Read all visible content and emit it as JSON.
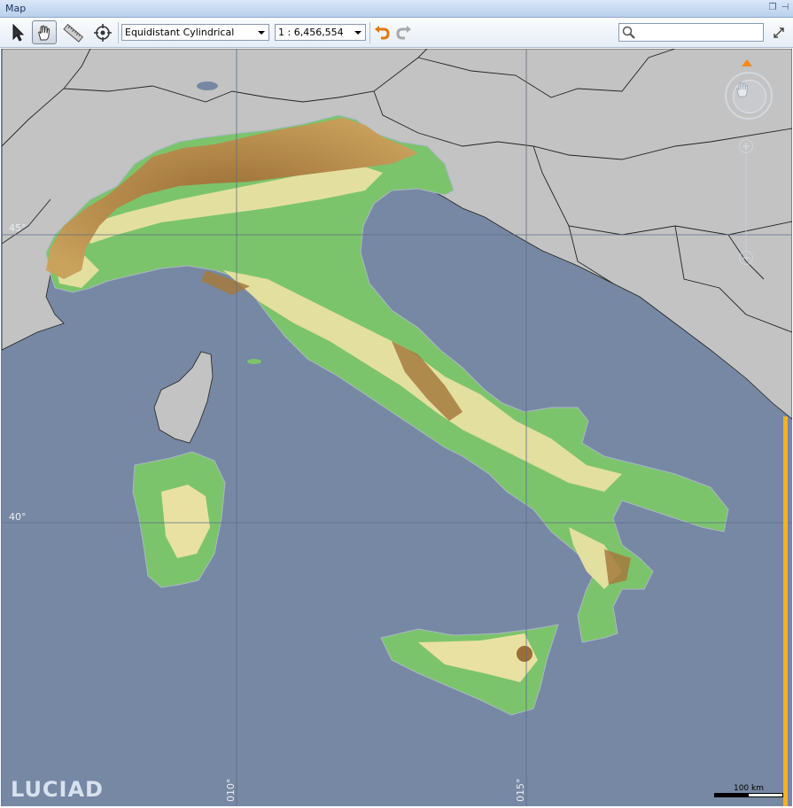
{
  "window": {
    "title": "Map"
  },
  "toolbar": {
    "tools": [
      {
        "name": "select-tool",
        "icon": "arrow-cursor-icon"
      },
      {
        "name": "pan-tool",
        "icon": "hand-icon",
        "active": true
      },
      {
        "name": "measure-tool",
        "icon": "ruler-icon"
      },
      {
        "name": "recenter-tool",
        "icon": "crosshair-icon"
      }
    ],
    "projection": {
      "value": "Equidistant Cylindrical"
    },
    "scale": {
      "value": "1 : 6,456,554"
    },
    "undo_icon": "undo-icon",
    "redo_icon": "redo-icon",
    "search": {
      "value": "",
      "placeholder": ""
    },
    "fullscreen_icon": "expand-icon"
  },
  "map": {
    "grid_labels": {
      "lat_45": "45°",
      "lat_40": "40°",
      "lon_10": "010°",
      "lon_15": "015°"
    },
    "logo": "LUCIAD",
    "scale_bar": {
      "label": "100 km"
    },
    "colors": {
      "sea": "#7688a3",
      "land_other": "#c3c3c3",
      "lowland": "#7cc46c",
      "hills": "#e9e1a2",
      "mountains": "#9c6e37",
      "accent": "#f0b420"
    }
  }
}
